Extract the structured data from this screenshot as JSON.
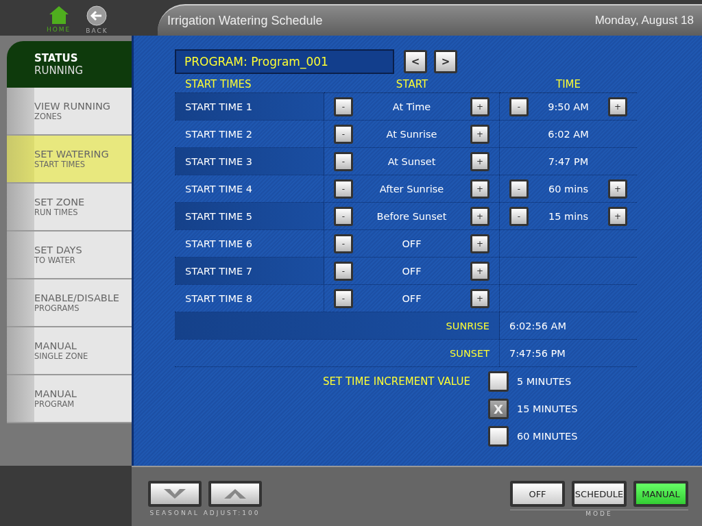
{
  "nav": {
    "home": "HOME",
    "back": "BACK"
  },
  "window": {
    "title": "Irrigation Watering Schedule",
    "date": "Monday, August 18"
  },
  "status": {
    "title": "STATUS",
    "value": "RUNNING"
  },
  "sidebar": {
    "items": [
      {
        "title": "VIEW RUNNING",
        "subtitle": "ZONES",
        "selected": false
      },
      {
        "title": "SET WATERING",
        "subtitle": "START TIMES",
        "selected": true
      },
      {
        "title": "SET ZONE",
        "subtitle": "RUN TIMES",
        "selected": false
      },
      {
        "title": "SET DAYS",
        "subtitle": "TO WATER",
        "selected": false
      },
      {
        "title": "ENABLE/DISABLE",
        "subtitle": "PROGRAMS",
        "selected": false
      },
      {
        "title": "MANUAL",
        "subtitle": "SINGLE ZONE",
        "selected": false
      },
      {
        "title": "MANUAL",
        "subtitle": "PROGRAM",
        "selected": false
      }
    ]
  },
  "program": {
    "label": "PROGRAM: Program_001",
    "prev": "<",
    "next": ">"
  },
  "table": {
    "columns": [
      "START TIMES",
      "START",
      "TIME"
    ],
    "rows": [
      {
        "label": "START TIME 1",
        "start": "At Time",
        "time": "9:50 AM",
        "kind": "adjustable"
      },
      {
        "label": "START TIME 2",
        "start": "At Sunrise",
        "time": "6:02 AM",
        "kind": "fixed"
      },
      {
        "label": "START TIME 3",
        "start": "At Sunset",
        "time": "7:47 PM",
        "kind": "fixed"
      },
      {
        "label": "START TIME 4",
        "start": "After Sunrise",
        "time": "60 mins",
        "kind": "adjustable"
      },
      {
        "label": "START TIME 5",
        "start": "Before Sunset",
        "time": "15 mins",
        "kind": "adjustable"
      },
      {
        "label": "START TIME 6",
        "start": "OFF",
        "kind": "off"
      },
      {
        "label": "START TIME 7",
        "start": "OFF",
        "kind": "off"
      },
      {
        "label": "START TIME 8",
        "start": "OFF",
        "kind": "off"
      }
    ],
    "minus": "-",
    "plus": "+"
  },
  "sun": [
    {
      "label": "SUNRISE",
      "value": "6:02:56 AM"
    },
    {
      "label": "SUNSET",
      "value": "7:47:56 PM"
    }
  ],
  "increment": {
    "label": "SET TIME INCREMENT VALUE",
    "mark": "X",
    "options": [
      {
        "label": "5 MINUTES",
        "checked": false
      },
      {
        "label": "15 MINUTES",
        "checked": true
      },
      {
        "label": "60 MINUTES",
        "checked": false
      }
    ]
  },
  "seasonal": {
    "label": "SEASONAL ADJUST:100"
  },
  "mode": {
    "label": "MODE",
    "buttons": [
      {
        "label": "OFF",
        "selected": false
      },
      {
        "label": "SCHEDULE",
        "selected": false
      },
      {
        "label": "MANUAL",
        "selected": true
      }
    ]
  }
}
